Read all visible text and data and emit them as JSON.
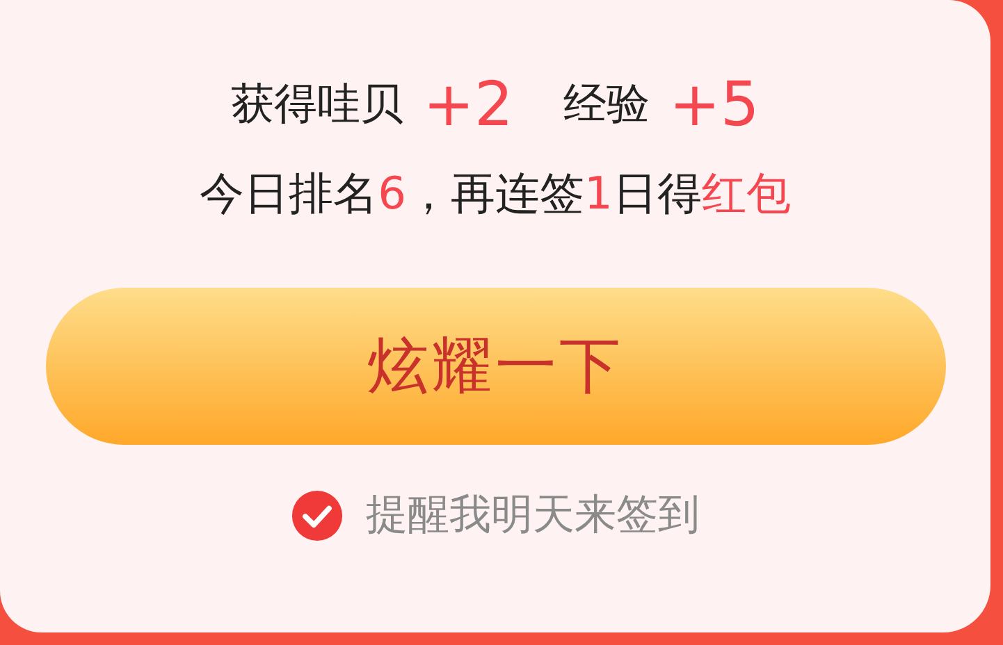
{
  "rewards": [
    {
      "label": "获得哇贝",
      "value": "+2"
    },
    {
      "label": "经验",
      "value": "+5"
    }
  ],
  "rank_line": [
    {
      "text": "今日排名",
      "highlight": false
    },
    {
      "text": "6",
      "highlight": true
    },
    {
      "text": "，再连签",
      "highlight": false
    },
    {
      "text": "1",
      "highlight": true
    },
    {
      "text": "日得",
      "highlight": false
    },
    {
      "text": "红包",
      "highlight": true
    }
  ],
  "share_button": {
    "label": "炫耀一下"
  },
  "reminder": {
    "label": "提醒我明天来签到",
    "checked": true
  }
}
